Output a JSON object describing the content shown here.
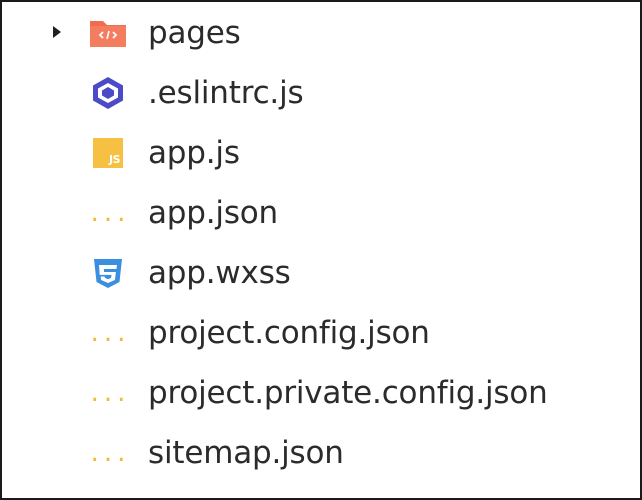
{
  "explorer": {
    "items": [
      {
        "label": "pages",
        "icon": "folder-pages-icon",
        "expandable": true
      },
      {
        "label": ".eslintrc.js",
        "icon": "eslint-icon"
      },
      {
        "label": "app.js",
        "icon": "javascript-icon",
        "badge": "JS"
      },
      {
        "label": "app.json",
        "icon": "json-icon",
        "glyph": "{...}"
      },
      {
        "label": "app.wxss",
        "icon": "css-icon"
      },
      {
        "label": "project.config.json",
        "icon": "json-icon",
        "glyph": "{...}"
      },
      {
        "label": "project.private.config.json",
        "icon": "json-icon",
        "glyph": "{...}"
      },
      {
        "label": "sitemap.json",
        "icon": "json-icon",
        "glyph": "{...}"
      }
    ]
  },
  "colors": {
    "folder": "#f26b4f",
    "folder_dark": "#e05a3f",
    "eslint": "#4b4bc9",
    "javascript": "#f6c142",
    "json": "#f5b83d",
    "css": "#3c8fe0",
    "text": "#2b2b2b"
  }
}
